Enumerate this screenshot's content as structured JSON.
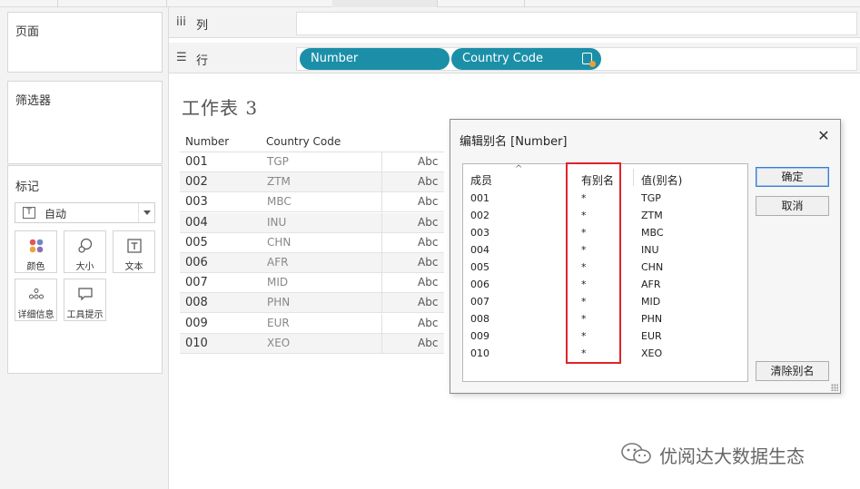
{
  "cards": {
    "pages": "页面",
    "filters": "筛选器",
    "marks": "标记"
  },
  "marks": {
    "type_value": "自动",
    "buttons": [
      {
        "label": "颜色",
        "icon": "color-dots-icon"
      },
      {
        "label": "大小",
        "icon": "size-icon"
      },
      {
        "label": "文本",
        "icon": "text-icon"
      },
      {
        "label": "详细信息",
        "icon": "detail-icon"
      },
      {
        "label": "工具提示",
        "icon": "tooltip-icon"
      }
    ]
  },
  "shelves": {
    "columns_label": "列",
    "rows_label": "行",
    "row_pills": [
      "Number",
      "Country Code"
    ]
  },
  "worksheet": {
    "title": "工作表 3",
    "headers": [
      "Number",
      "Country Code"
    ],
    "rows": [
      {
        "number": "001",
        "code": "TGP",
        "abc": "Abc"
      },
      {
        "number": "002",
        "code": "ZTM",
        "abc": "Abc"
      },
      {
        "number": "003",
        "code": "MBC",
        "abc": "Abc"
      },
      {
        "number": "004",
        "code": "INU",
        "abc": "Abc"
      },
      {
        "number": "005",
        "code": "CHN",
        "abc": "Abc"
      },
      {
        "number": "006",
        "code": "AFR",
        "abc": "Abc"
      },
      {
        "number": "007",
        "code": "MID",
        "abc": "Abc"
      },
      {
        "number": "008",
        "code": "PHN",
        "abc": "Abc"
      },
      {
        "number": "009",
        "code": "EUR",
        "abc": "Abc"
      },
      {
        "number": "010",
        "code": "XEO",
        "abc": "Abc"
      }
    ]
  },
  "dialog": {
    "title": "编辑别名 [Number]",
    "columns": [
      "成员",
      "有别名",
      "值(别名)"
    ],
    "rows": [
      {
        "member": "001",
        "has_alias": "*",
        "alias": "TGP"
      },
      {
        "member": "002",
        "has_alias": "*",
        "alias": "ZTM"
      },
      {
        "member": "003",
        "has_alias": "*",
        "alias": "MBC"
      },
      {
        "member": "004",
        "has_alias": "*",
        "alias": "INU"
      },
      {
        "member": "005",
        "has_alias": "*",
        "alias": "CHN"
      },
      {
        "member": "006",
        "has_alias": "*",
        "alias": "AFR"
      },
      {
        "member": "007",
        "has_alias": "*",
        "alias": "MID"
      },
      {
        "member": "008",
        "has_alias": "*",
        "alias": "PHN"
      },
      {
        "member": "009",
        "has_alias": "*",
        "alias": "EUR"
      },
      {
        "member": "010",
        "has_alias": "*",
        "alias": "XEO"
      }
    ],
    "ok_label": "确定",
    "cancel_label": "取消",
    "clear_label": "清除别名"
  },
  "watermark": {
    "text": "优阅达大数据生态"
  },
  "colors": {
    "pill": "#1b8fa8",
    "highlight": "#e0232a"
  }
}
